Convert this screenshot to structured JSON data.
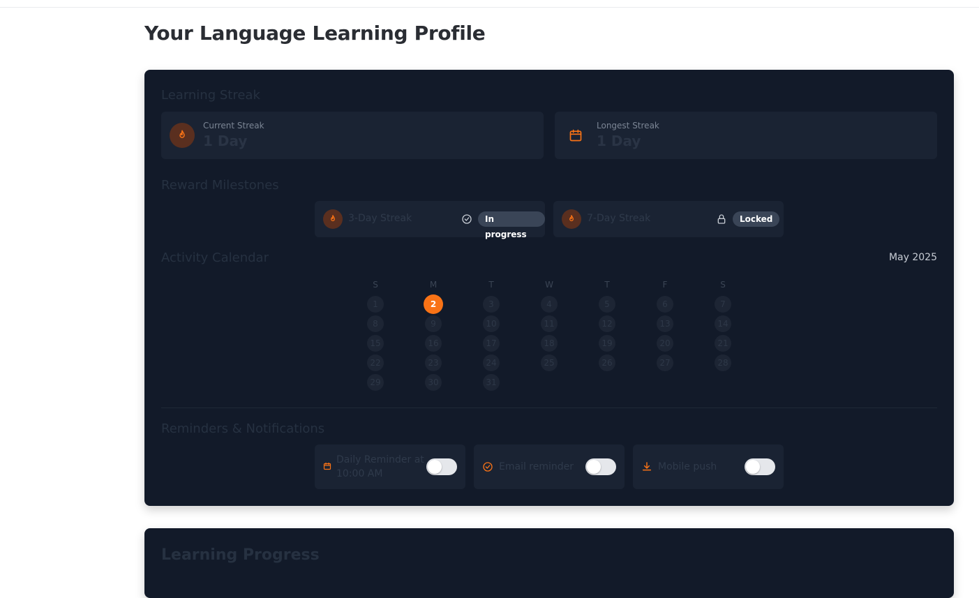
{
  "page": {
    "title": "Your Language Learning Profile"
  },
  "streak": {
    "title": "Learning Streak",
    "current": {
      "label": "Current Streak",
      "value": "1 Day",
      "icon": "flame-icon"
    },
    "longest": {
      "label": "Longest Streak",
      "value": "1 Day",
      "icon": "calendar-icon"
    }
  },
  "milestones": {
    "title": "Reward Milestones",
    "items": [
      {
        "name": "3-Day Streak",
        "status": "In progress",
        "status_icon": "check-circle-icon",
        "icon": "flame-icon"
      },
      {
        "name": "7-Day Streak",
        "status": "Locked",
        "status_icon": "lock-icon",
        "icon": "flame-icon"
      }
    ]
  },
  "calendar": {
    "title": "Activity Calendar",
    "month": "May 2025",
    "weekdays": [
      "S",
      "M",
      "T",
      "W",
      "T",
      "F",
      "S"
    ],
    "active_day": "2",
    "days": [
      [
        "1",
        "2",
        "3",
        "4",
        "5",
        "6",
        "7"
      ],
      [
        "8",
        "9",
        "10",
        "11",
        "12",
        "13",
        "14"
      ],
      [
        "15",
        "16",
        "17",
        "18",
        "19",
        "20",
        "21"
      ],
      [
        "22",
        "23",
        "24",
        "25",
        "26",
        "27",
        "28"
      ],
      [
        "29",
        "30",
        "31"
      ]
    ]
  },
  "reminders": {
    "title": "Reminders & Notifications",
    "items": [
      {
        "label_line1": "Daily Reminder at",
        "label_line2": "10:00 AM",
        "icon": "calendar-icon",
        "enabled": false
      },
      {
        "label_line1": "Email reminder",
        "label_line2": "",
        "icon": "check-circle-icon",
        "enabled": false
      },
      {
        "label_line1": "Mobile push",
        "label_line2": "",
        "icon": "download-icon",
        "enabled": false
      }
    ]
  },
  "progress": {
    "title": "Learning Progress"
  },
  "colors": {
    "accent": "#f97316",
    "card_bg": "#121a29",
    "tile_bg": "#1a2333"
  }
}
